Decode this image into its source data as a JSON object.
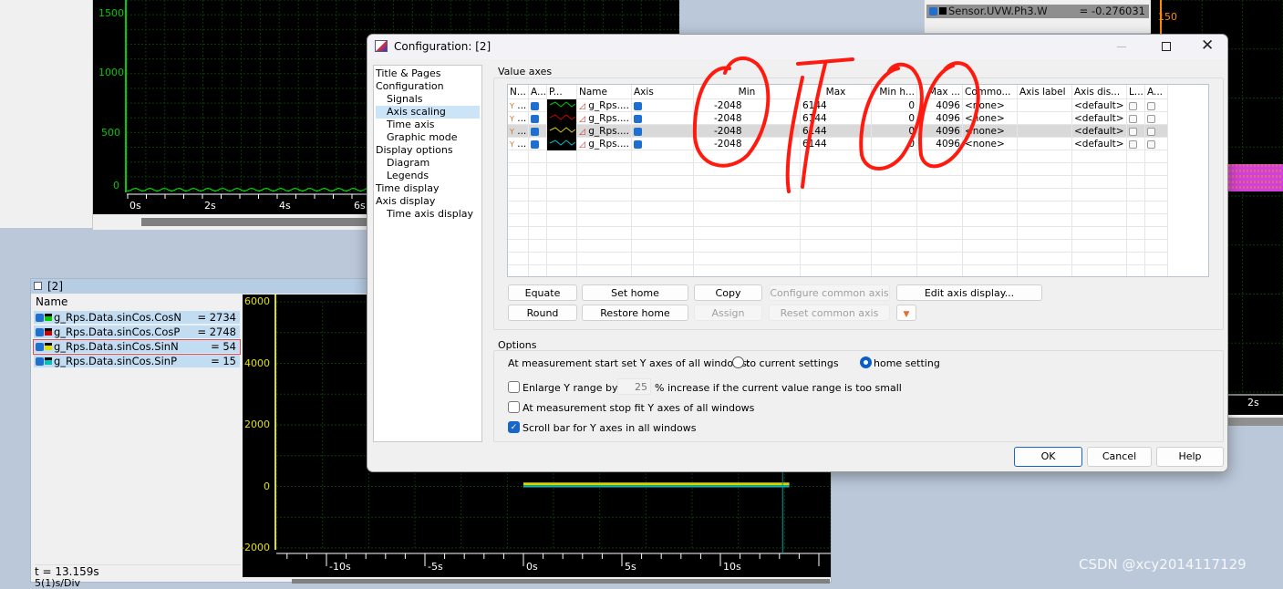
{
  "top_left_window": {
    "y_ticks": [
      "1500",
      "1000",
      "500",
      "0"
    ],
    "x_ticks": [
      "0s",
      "2s",
      "4s",
      "6s"
    ],
    "axis_color": "#00cc00"
  },
  "top_right_window": {
    "signal_name": "Sensor.UVW.Ph3.W",
    "signal_value": "= -0.276031",
    "y_tick": "150",
    "x_tick": "2s",
    "axis_color": "#ff8c00"
  },
  "bottom_window": {
    "title": "[2]",
    "list_header": "Name",
    "signals": [
      {
        "name": "g_Rps.Data.sinCos.CosN",
        "value": "= 2734",
        "color": "#00cc00"
      },
      {
        "name": "g_Rps.Data.sinCos.CosP",
        "value": "= 2748",
        "color": "#cc0000"
      },
      {
        "name": "g_Rps.Data.sinCos.SinN",
        "value": "= 54",
        "color": "#e0e000"
      },
      {
        "name": "g_Rps.Data.sinCos.SinP",
        "value": "= 15",
        "color": "#00c0c0"
      }
    ],
    "cursor_time": "t = 13.159s",
    "time_per_div": "5(1)s/Div",
    "y_ticks": [
      "6000",
      "4000",
      "2000",
      "0",
      "-2000"
    ],
    "x_ticks": [
      "-10s",
      "-5s",
      "0s",
      "5s",
      "10s"
    ],
    "axis_color": "#e0e000"
  },
  "dialog": {
    "title": "Configuration: [2]",
    "tree": [
      {
        "label": "Title & Pages",
        "indent": false
      },
      {
        "label": "Configuration",
        "indent": false
      },
      {
        "label": "Signals",
        "indent": true
      },
      {
        "label": "Axis scaling",
        "indent": true,
        "selected": true
      },
      {
        "label": "Time axis",
        "indent": true
      },
      {
        "label": "Graphic mode",
        "indent": true
      },
      {
        "label": "Display options",
        "indent": false
      },
      {
        "label": "Diagram",
        "indent": true
      },
      {
        "label": "Legends",
        "indent": true
      },
      {
        "label": "Time display",
        "indent": false
      },
      {
        "label": "Axis display",
        "indent": false
      },
      {
        "label": "Time axis display",
        "indent": true
      }
    ],
    "value_axes_label": "Value axes",
    "columns": [
      "N...",
      "A...",
      "P...",
      "Name",
      "Axis",
      "Min",
      "Max",
      "Min h...",
      "Max ...",
      "Commo...",
      "Axis label",
      "Axis dis...",
      "L...",
      "A..."
    ],
    "rows": [
      {
        "n": "...",
        "name": "g_Rps....",
        "min": "-2048",
        "max": "6144",
        "min_home": "0",
        "max_home": "4096",
        "common": "<none>",
        "axis_label": "",
        "axis_display": "<default>",
        "color": "#00cc00",
        "selected": false
      },
      {
        "n": "...",
        "name": "g_Rps....",
        "min": "-2048",
        "max": "6144",
        "min_home": "0",
        "max_home": "4096",
        "common": "<none>",
        "axis_label": "",
        "axis_display": "<default>",
        "color": "#cc0000",
        "selected": false
      },
      {
        "n": "...",
        "name": "g_Rps....",
        "min": "-2048",
        "max": "6144",
        "min_home": "0",
        "max_home": "4096",
        "common": "<none>",
        "axis_label": "",
        "axis_display": "<default>",
        "color": "#d0d000",
        "selected": true
      },
      {
        "n": "...",
        "name": "g_Rps....",
        "min": "-2048",
        "max": "6144",
        "min_home": "0",
        "max_home": "4096",
        "common": "<none>",
        "axis_label": "",
        "axis_display": "<default>",
        "color": "#00c0c0",
        "selected": false
      }
    ],
    "buttons": {
      "equate": "Equate",
      "set_home": "Set home",
      "copy": "Copy",
      "configure_common_axis": "Configure common axis",
      "edit_axis_display": "Edit axis display...",
      "round": "Round",
      "restore_home": "Restore home",
      "assign": "Assign",
      "reset_common_axis": "Reset common axis"
    },
    "options": {
      "label": "Options",
      "start_label": "At measurement start set Y axes of all windows:",
      "radio_current": "to current settings",
      "radio_home": "home setting",
      "radio_selected": "home",
      "enlarge_label": "Enlarge Y range by",
      "enlarge_value": "25",
      "enlarge_suffix": "% increase if the current value range is too small",
      "enlarge_checked": false,
      "stop_fit_label": "At measurement stop fit Y axes of all windows",
      "stop_fit_checked": false,
      "scrollbar_label": "Scroll bar for Y axes in all windows",
      "scrollbar_checked": true
    },
    "footer": {
      "ok": "OK",
      "cancel": "Cancel",
      "help": "Help"
    }
  },
  "watermark": "CSDN @xcy2014117129",
  "annotation_color": "#ff0000"
}
